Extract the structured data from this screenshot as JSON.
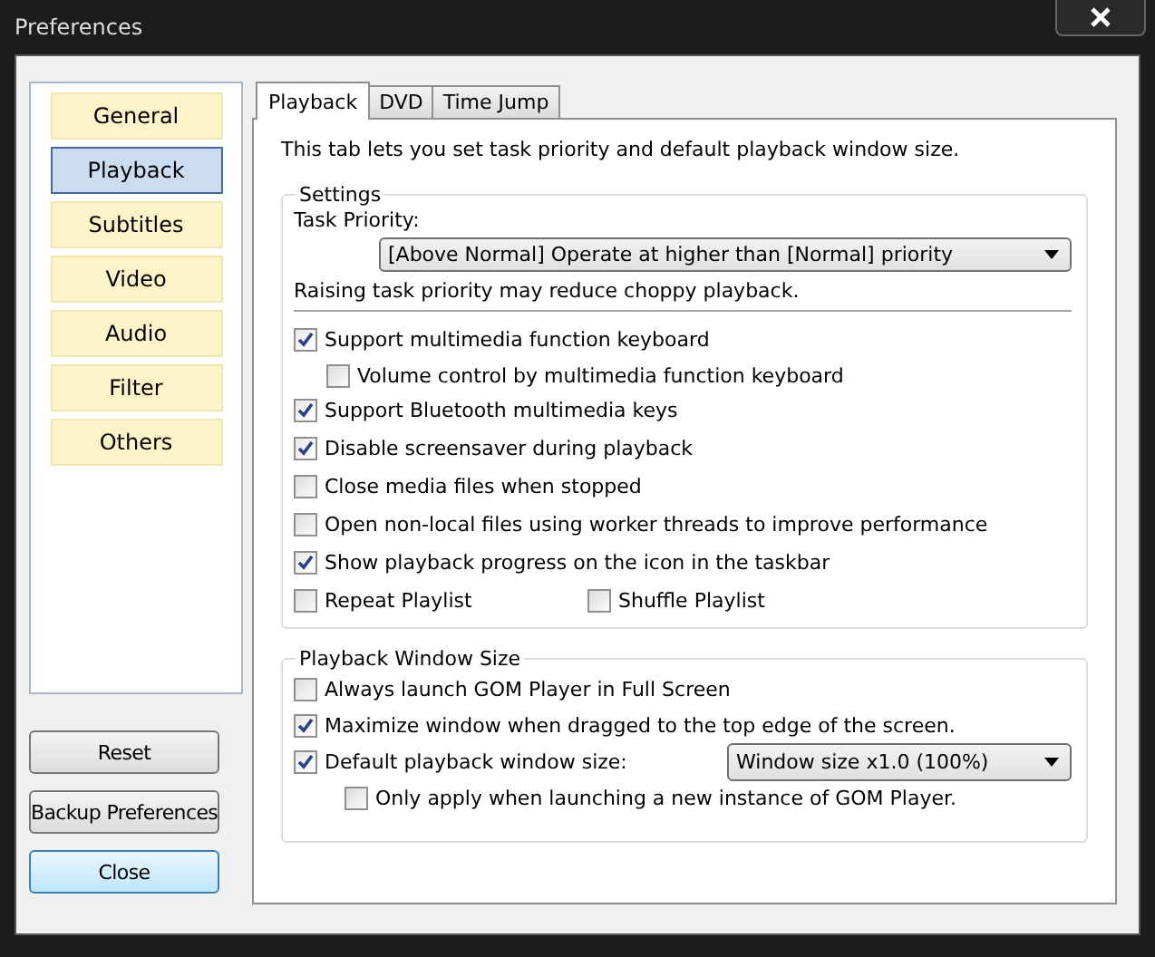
{
  "window": {
    "title": "Preferences"
  },
  "sidebar": {
    "items": [
      {
        "label": "General",
        "selected": false
      },
      {
        "label": "Playback",
        "selected": true
      },
      {
        "label": "Subtitles",
        "selected": false
      },
      {
        "label": "Video",
        "selected": false
      },
      {
        "label": "Audio",
        "selected": false
      },
      {
        "label": "Filter",
        "selected": false
      },
      {
        "label": "Others",
        "selected": false
      }
    ],
    "buttons": [
      {
        "label": "Reset",
        "default": false
      },
      {
        "label": "Backup Preferences",
        "default": false
      },
      {
        "label": "Close",
        "default": true
      }
    ]
  },
  "tabs": [
    {
      "label": "Playback",
      "selected": true
    },
    {
      "label": "DVD",
      "selected": false
    },
    {
      "label": "Time Jump",
      "selected": false
    }
  ],
  "intro": "This tab lets you set task priority and default playback window size.",
  "settings": {
    "title": "Settings",
    "priority_label": "Task Priority:",
    "priority_value": "[Above Normal] Operate at higher than [Normal] priority",
    "priority_note": "Raising task priority may reduce choppy playback.",
    "options": [
      {
        "kind": "checkbox",
        "label": "Support multimedia function keyboard",
        "checked": true,
        "children": [
          {
            "kind": "checkbox",
            "label": "Volume control by multimedia function keyboard",
            "checked": false
          }
        ]
      },
      {
        "kind": "checkbox",
        "label": "Support Bluetooth multimedia keys",
        "checked": true
      },
      {
        "kind": "checkbox",
        "label": "Disable screensaver during playback",
        "checked": true
      },
      {
        "kind": "checkbox",
        "label": "Close media files when stopped",
        "checked": false
      },
      {
        "kind": "checkbox",
        "label": "Open non-local files using worker threads to improve performance",
        "checked": false
      },
      {
        "kind": "checkbox",
        "label": "Show playback progress on the icon in the taskbar",
        "checked": true
      },
      {
        "kind": "pair",
        "items": [
          {
            "label": "Repeat Playlist",
            "checked": false
          },
          {
            "label": "Shuffle Playlist",
            "checked": false
          }
        ]
      }
    ]
  },
  "window_size": {
    "title": "Playback Window Size",
    "options": [
      {
        "kind": "checkbox",
        "label": "Always launch GOM Player in Full Screen",
        "checked": false
      },
      {
        "kind": "checkbox",
        "label": "Maximize window when dragged to the top edge of the screen.",
        "checked": true
      },
      {
        "kind": "select",
        "label": "Default playback window size:",
        "checked": true,
        "value": "Window size x1.0 (100%)",
        "children": [
          {
            "kind": "checkbox",
            "label": "Only apply when launching a new instance of GOM Player.",
            "checked": false
          }
        ]
      }
    ]
  }
}
